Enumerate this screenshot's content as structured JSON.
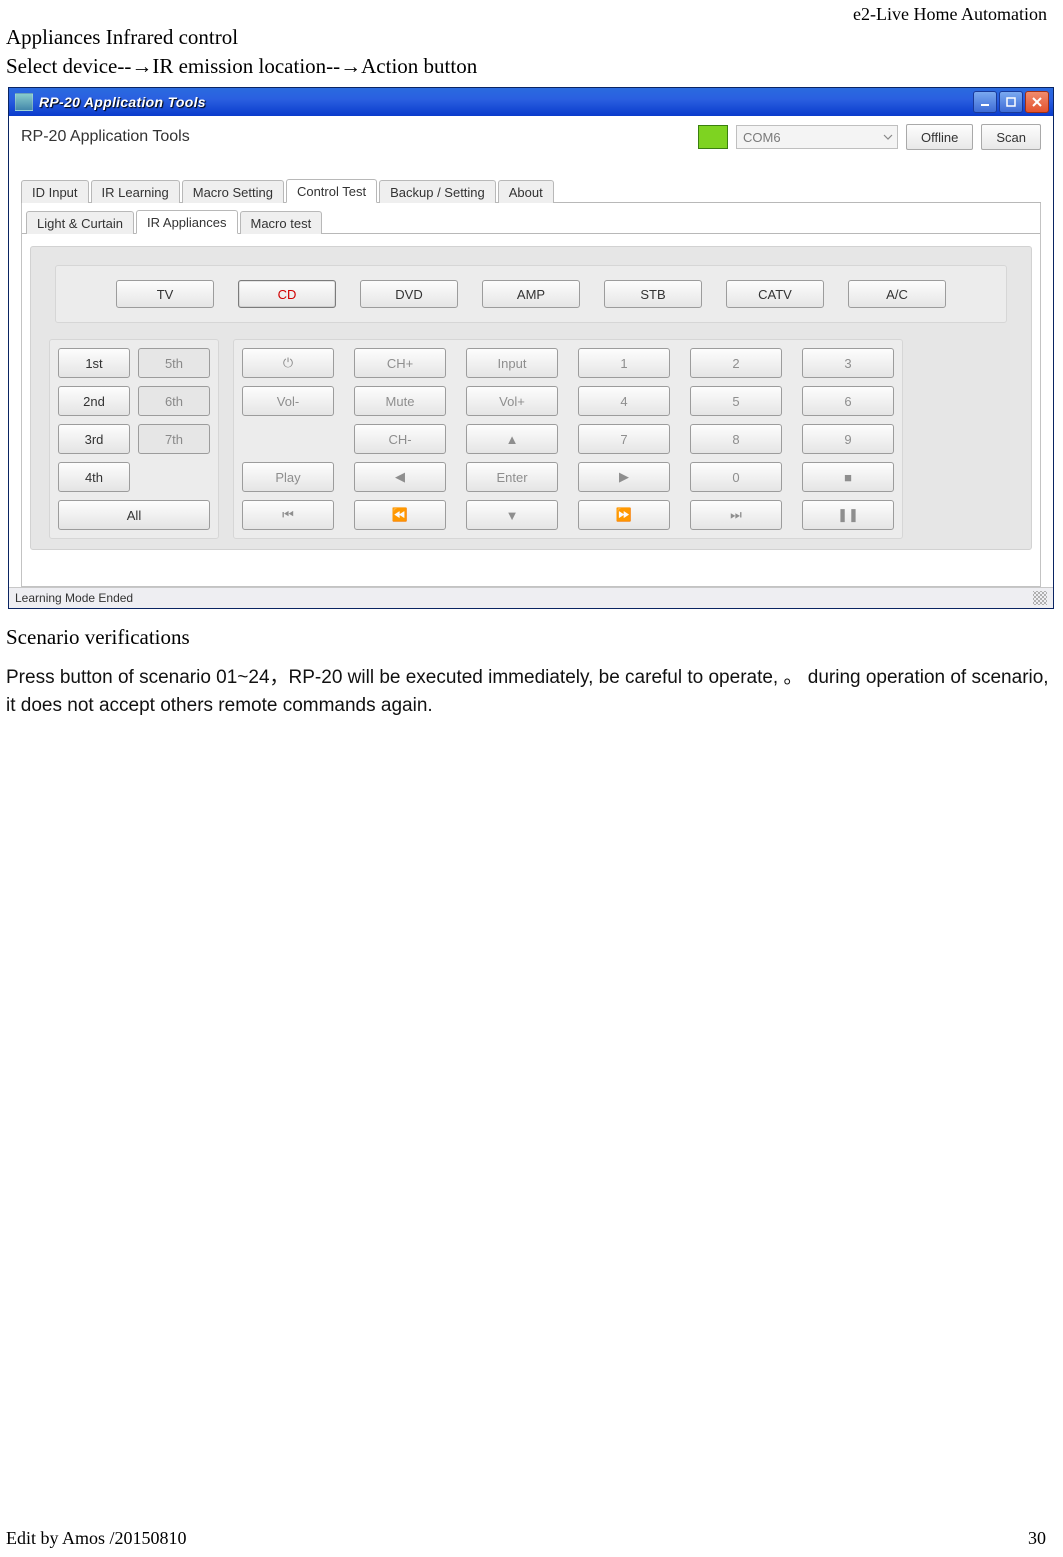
{
  "header_right": "e2-Live Home Automation",
  "heading1": "Appliances Infrared control",
  "flow": "Select device--→IR emission location--→Action button",
  "window": {
    "title": "RP-20 Application Tools",
    "topbar": {
      "label": "RP-20 Application Tools",
      "port": "COM6",
      "offline": "Offline",
      "scan": "Scan"
    },
    "tabs": [
      "ID Input",
      "IR Learning",
      "Macro Setting",
      "Control Test",
      "Backup / Setting",
      "About"
    ],
    "active_tab": 3,
    "subtabs": [
      "Light & Curtain",
      "IR Appliances",
      "Macro test"
    ],
    "active_subtab": 1,
    "devices": [
      "TV",
      "CD",
      "DVD",
      "AMP",
      "STB",
      "CATV",
      "A/C"
    ],
    "device_selected": 1,
    "locations": [
      "1st",
      "5th",
      "2nd",
      "6th",
      "3rd",
      "7th",
      "4th"
    ],
    "loc_all": "All",
    "remote_rows": [
      [
        "⏻",
        "CH+",
        "Input",
        "1",
        "2",
        "3"
      ],
      [
        "Vol-",
        "Mute",
        "Vol+",
        "4",
        "5",
        "6"
      ],
      [
        "",
        "CH-",
        "▲",
        "7",
        "8",
        "9"
      ],
      [
        "Play",
        "◀",
        "Enter",
        "▶",
        "0",
        "■"
      ],
      [
        "⏮",
        "⏪",
        "▼",
        "⏩",
        "⏭",
        "❚❚"
      ]
    ],
    "status": "Learning Mode Ended"
  },
  "heading2": "Scenario verifications",
  "para": "Press button of scenario 01~24，RP-20 will be executed immediately, be careful to operate,   。 during operation of scenario, it does not accept others remote commands again.",
  "footer_left": "Edit by Amos /20150810",
  "footer_right": "30"
}
